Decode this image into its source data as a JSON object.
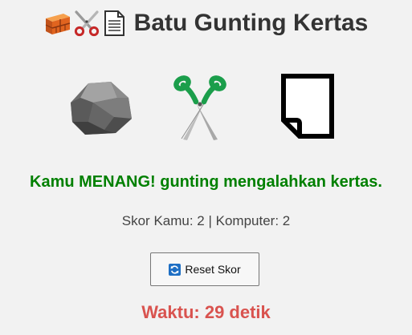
{
  "header": {
    "title": "Batu Gunting Kertas",
    "icons": [
      "bricks-icon",
      "scissors-icon",
      "page-icon"
    ]
  },
  "choices": [
    {
      "name": "batu",
      "icon": "rock-icon"
    },
    {
      "name": "gunting",
      "icon": "scissors-icon"
    },
    {
      "name": "kertas",
      "icon": "paper-icon"
    }
  ],
  "result": {
    "text": "Kamu MENANG! gunting mengalahkan kertas.",
    "color": "#008000"
  },
  "score": {
    "text": "Skor Kamu: 2 | Komputer: 2"
  },
  "reset_button": {
    "label": "Reset Skor",
    "icon": "refresh-icon"
  },
  "timer": {
    "text": "Waktu: 29 detik",
    "color": "#d9534f"
  }
}
